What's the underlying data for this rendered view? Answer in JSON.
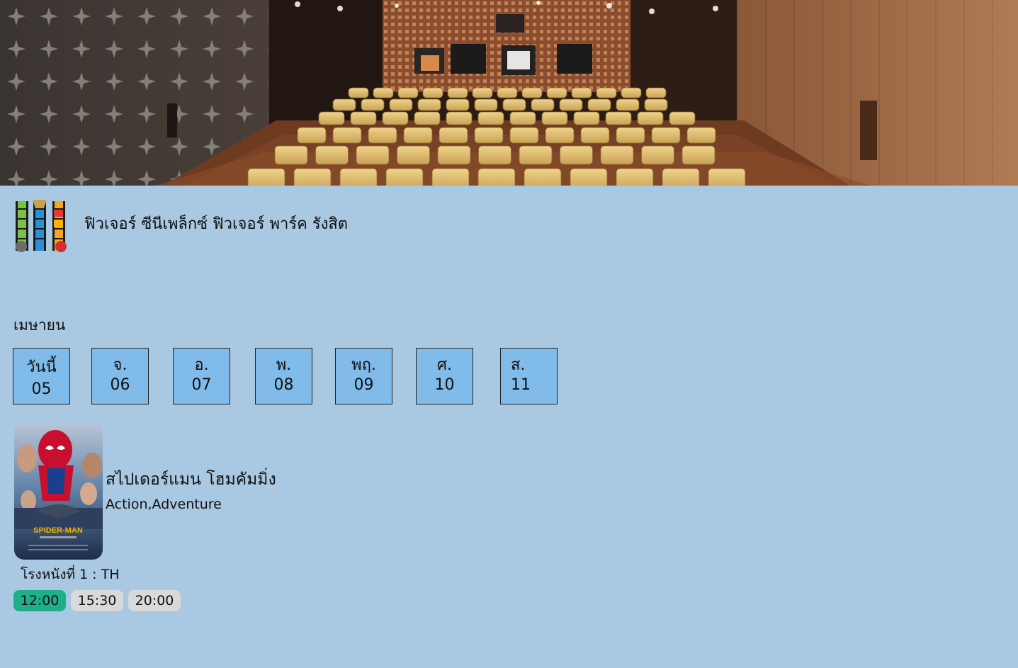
{
  "cinema": {
    "name": "ฟิวเจอร์ ซีนีเพล็กซ์ ฟิวเจอร์ พาร์ค รังสิต"
  },
  "calendar": {
    "month": "เมษายน",
    "days": [
      {
        "label": "วันนี้",
        "date": "05"
      },
      {
        "label": "จ.",
        "date": "06"
      },
      {
        "label": "อ.",
        "date": "07"
      },
      {
        "label": "พ.",
        "date": "08"
      },
      {
        "label": "พฤ.",
        "date": "09"
      },
      {
        "label": "ศ.",
        "date": "10"
      },
      {
        "label": "ส.",
        "date": "11"
      }
    ]
  },
  "movie": {
    "title": "สไปเดอร์แมน โฮมคัมมิ่ง",
    "genre": "Action,Adventure",
    "poster_text": "SPIDER-MAN",
    "theater": "โรงหนังที่ 1 : TH",
    "showtimes": [
      {
        "time": "12:00",
        "selected": true
      },
      {
        "time": "15:30",
        "selected": false
      },
      {
        "time": "20:00",
        "selected": false
      }
    ]
  },
  "colors": {
    "page_background": "#a9c8e2",
    "day_button": "#80bbe9",
    "showtime_selected": "#1eae8a",
    "showtime_default": "#d9d9d9"
  },
  "icons": {
    "logo": "film-strip-logo-icon"
  }
}
